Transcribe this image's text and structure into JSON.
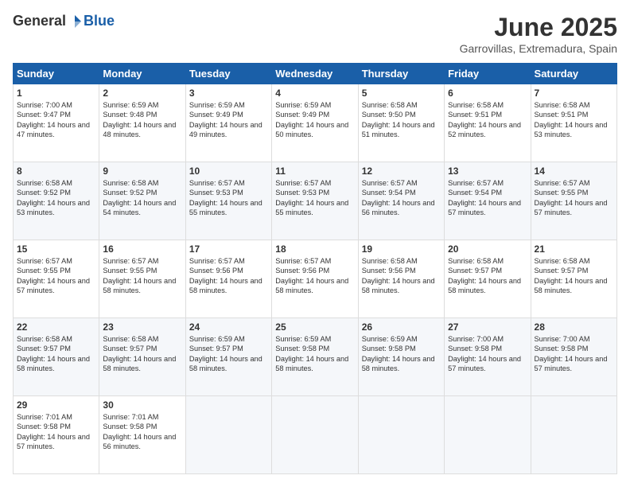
{
  "logo": {
    "general": "General",
    "blue": "Blue"
  },
  "header": {
    "title": "June 2025",
    "subtitle": "Garrovillas, Extremadura, Spain"
  },
  "days": [
    "Sunday",
    "Monday",
    "Tuesday",
    "Wednesday",
    "Thursday",
    "Friday",
    "Saturday"
  ],
  "weeks": [
    [
      {
        "day": "1",
        "sunrise": "7:00 AM",
        "sunset": "9:47 PM",
        "daylight": "14 hours and 47 minutes."
      },
      {
        "day": "2",
        "sunrise": "6:59 AM",
        "sunset": "9:48 PM",
        "daylight": "14 hours and 48 minutes."
      },
      {
        "day": "3",
        "sunrise": "6:59 AM",
        "sunset": "9:49 PM",
        "daylight": "14 hours and 49 minutes."
      },
      {
        "day": "4",
        "sunrise": "6:59 AM",
        "sunset": "9:49 PM",
        "daylight": "14 hours and 50 minutes."
      },
      {
        "day": "5",
        "sunrise": "6:58 AM",
        "sunset": "9:50 PM",
        "daylight": "14 hours and 51 minutes."
      },
      {
        "day": "6",
        "sunrise": "6:58 AM",
        "sunset": "9:51 PM",
        "daylight": "14 hours and 52 minutes."
      },
      {
        "day": "7",
        "sunrise": "6:58 AM",
        "sunset": "9:51 PM",
        "daylight": "14 hours and 53 minutes."
      }
    ],
    [
      {
        "day": "8",
        "sunrise": "6:58 AM",
        "sunset": "9:52 PM",
        "daylight": "14 hours and 53 minutes."
      },
      {
        "day": "9",
        "sunrise": "6:58 AM",
        "sunset": "9:52 PM",
        "daylight": "14 hours and 54 minutes."
      },
      {
        "day": "10",
        "sunrise": "6:57 AM",
        "sunset": "9:53 PM",
        "daylight": "14 hours and 55 minutes."
      },
      {
        "day": "11",
        "sunrise": "6:57 AM",
        "sunset": "9:53 PM",
        "daylight": "14 hours and 55 minutes."
      },
      {
        "day": "12",
        "sunrise": "6:57 AM",
        "sunset": "9:54 PM",
        "daylight": "14 hours and 56 minutes."
      },
      {
        "day": "13",
        "sunrise": "6:57 AM",
        "sunset": "9:54 PM",
        "daylight": "14 hours and 57 minutes."
      },
      {
        "day": "14",
        "sunrise": "6:57 AM",
        "sunset": "9:55 PM",
        "daylight": "14 hours and 57 minutes."
      }
    ],
    [
      {
        "day": "15",
        "sunrise": "6:57 AM",
        "sunset": "9:55 PM",
        "daylight": "14 hours and 57 minutes."
      },
      {
        "day": "16",
        "sunrise": "6:57 AM",
        "sunset": "9:55 PM",
        "daylight": "14 hours and 58 minutes."
      },
      {
        "day": "17",
        "sunrise": "6:57 AM",
        "sunset": "9:56 PM",
        "daylight": "14 hours and 58 minutes."
      },
      {
        "day": "18",
        "sunrise": "6:57 AM",
        "sunset": "9:56 PM",
        "daylight": "14 hours and 58 minutes."
      },
      {
        "day": "19",
        "sunrise": "6:58 AM",
        "sunset": "9:56 PM",
        "daylight": "14 hours and 58 minutes."
      },
      {
        "day": "20",
        "sunrise": "6:58 AM",
        "sunset": "9:57 PM",
        "daylight": "14 hours and 58 minutes."
      },
      {
        "day": "21",
        "sunrise": "6:58 AM",
        "sunset": "9:57 PM",
        "daylight": "14 hours and 58 minutes."
      }
    ],
    [
      {
        "day": "22",
        "sunrise": "6:58 AM",
        "sunset": "9:57 PM",
        "daylight": "14 hours and 58 minutes."
      },
      {
        "day": "23",
        "sunrise": "6:58 AM",
        "sunset": "9:57 PM",
        "daylight": "14 hours and 58 minutes."
      },
      {
        "day": "24",
        "sunrise": "6:59 AM",
        "sunset": "9:57 PM",
        "daylight": "14 hours and 58 minutes."
      },
      {
        "day": "25",
        "sunrise": "6:59 AM",
        "sunset": "9:58 PM",
        "daylight": "14 hours and 58 minutes."
      },
      {
        "day": "26",
        "sunrise": "6:59 AM",
        "sunset": "9:58 PM",
        "daylight": "14 hours and 58 minutes."
      },
      {
        "day": "27",
        "sunrise": "7:00 AM",
        "sunset": "9:58 PM",
        "daylight": "14 hours and 57 minutes."
      },
      {
        "day": "28",
        "sunrise": "7:00 AM",
        "sunset": "9:58 PM",
        "daylight": "14 hours and 57 minutes."
      }
    ],
    [
      {
        "day": "29",
        "sunrise": "7:01 AM",
        "sunset": "9:58 PM",
        "daylight": "14 hours and 57 minutes."
      },
      {
        "day": "30",
        "sunrise": "7:01 AM",
        "sunset": "9:58 PM",
        "daylight": "14 hours and 56 minutes."
      },
      null,
      null,
      null,
      null,
      null
    ]
  ]
}
